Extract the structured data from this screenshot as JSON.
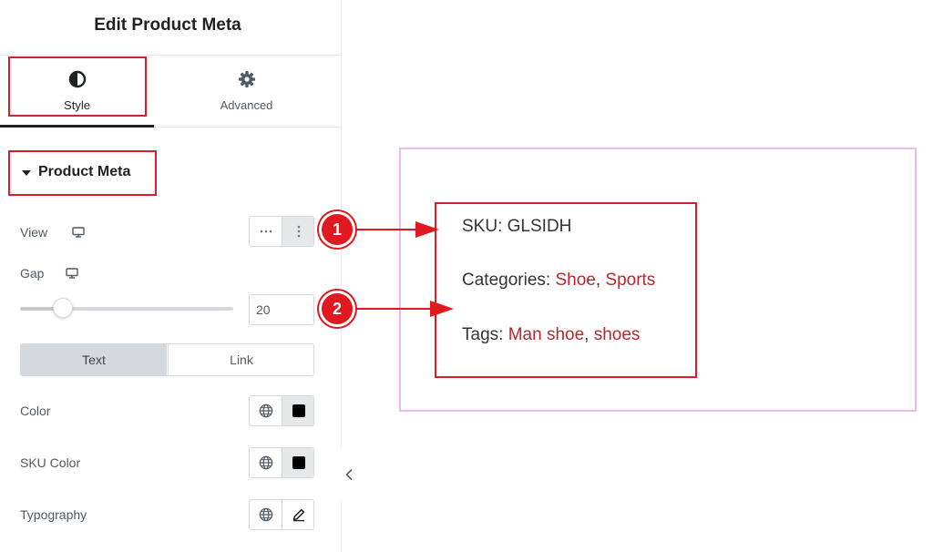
{
  "panel": {
    "title": "Edit Product Meta",
    "tabs": [
      {
        "label": "Style",
        "icon": "half-circle-icon",
        "active": true
      },
      {
        "label": "Advanced",
        "icon": "gear-icon",
        "active": false
      }
    ],
    "section": {
      "title": "Product Meta",
      "icon": "caret-down-icon"
    },
    "view": {
      "label": "View",
      "icon": "monitor-icon",
      "options": [
        "horizontal-dots-icon",
        "vertical-dots-icon"
      ],
      "selected": "vertical-dots-icon"
    },
    "gap": {
      "label": "Gap",
      "icon": "monitor-icon",
      "value": "20",
      "slider_fraction": 0.2
    },
    "text_link_toggle": {
      "options": [
        "Text",
        "Link"
      ],
      "selected": "Text"
    },
    "color": {
      "label": "Color",
      "icon": "globe-icon",
      "swatch": "#000000"
    },
    "sku_color": {
      "label": "SKU Color",
      "icon": "globe-icon",
      "swatch": "#000000"
    },
    "typography": {
      "label": "Typography",
      "icon": "globe-icon",
      "edit_icon": "pencil-icon"
    },
    "collapse_icon": "chevron-left-icon"
  },
  "preview": {
    "sku": {
      "label": "SKU:",
      "value": "GLSIDH"
    },
    "categories": {
      "label": "Categories:",
      "links": [
        "Shoe",
        "Sports"
      ],
      "separator": ","
    },
    "tags": {
      "label": "Tags:",
      "links": [
        "Man shoe",
        "shoes"
      ],
      "separator": ","
    }
  },
  "annotations": {
    "markers": [
      "1",
      "2"
    ]
  },
  "colors": {
    "accent_red": "#d61f2c",
    "link": "#b8272e",
    "preview_border": "#f2b8f0",
    "text": "#333333",
    "panel_text": "#515962"
  }
}
